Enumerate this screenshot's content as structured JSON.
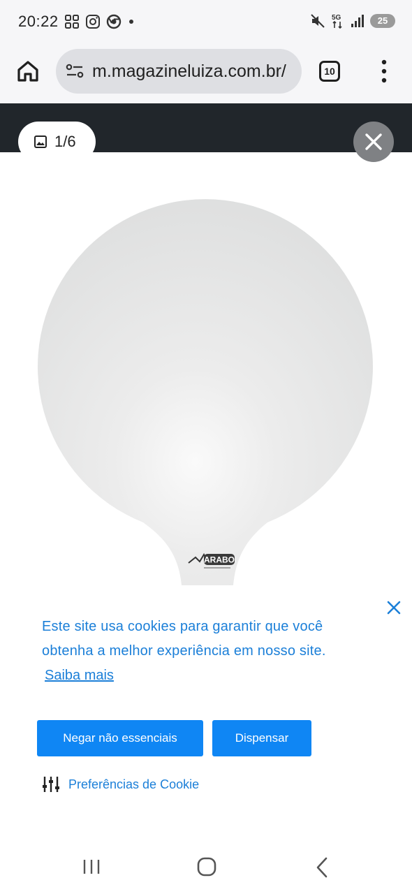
{
  "status_bar": {
    "time": "20:22",
    "battery": "25",
    "left_icons": [
      "qr-grid-icon",
      "instagram-icon",
      "chrome-icon",
      "dot-icon"
    ],
    "right_icons": [
      "mute-icon",
      "5g-icon",
      "signal-icon",
      "battery-icon"
    ]
  },
  "browser": {
    "url": "m.magazineluiza.com.br/",
    "tab_count": "10"
  },
  "gallery": {
    "counter": "1/6",
    "logo_text": "ARABO"
  },
  "cookie_banner": {
    "message": "Este site usa cookies para garantir que você obtenha a melhor experiência em nosso site.",
    "learn_more": "Saiba mais",
    "deny_button": "Negar não essenciais",
    "dismiss_button": "Dispensar",
    "preferences": "Preferências de Cookie"
  },
  "colors": {
    "accent": "#0f86f4",
    "link": "#1b7fd8",
    "header_dark": "#21262b"
  }
}
